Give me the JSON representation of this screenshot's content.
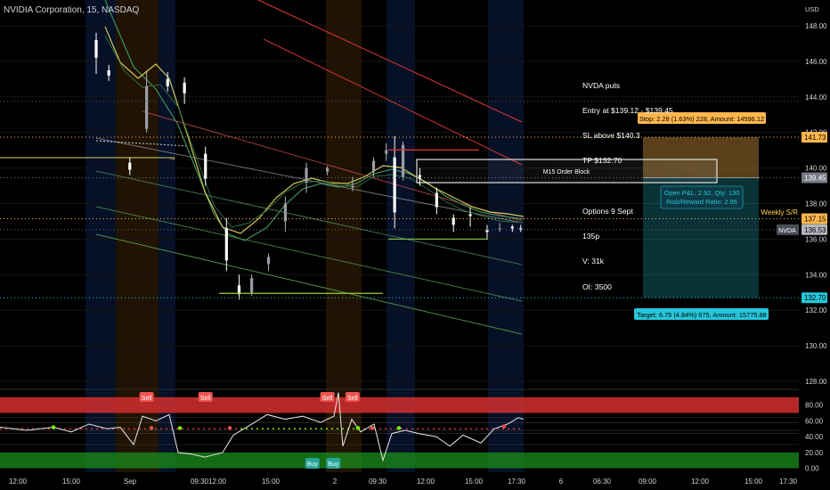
{
  "header": {
    "title": "NVIDIA Corporation, 15, NASDAQ"
  },
  "trade_note": {
    "entry_lines": [
      "NVDA puts",
      "Entry at $139.12 - $139.45",
      "SL above $140.3",
      "TP $132.70"
    ],
    "option_lines": [
      "Options 9 Sept",
      "135p",
      "V: 31k",
      "OI: 3500"
    ]
  },
  "labels": {
    "order_block": "M15 Order Block",
    "stop_box": "Stop: 2.28 (1.63%) 228, Amount: 14596.12",
    "pnl_line1": "Open P&L: 2.92, Qty: 130",
    "pnl_line2": "Risk/Reward Ratio: 2.96",
    "target_box": "Target: 6.75 (4.84%) 675, Amount: 15775.88",
    "weekly_sr": "Weekly S/R",
    "symbol_tag": "NVDA",
    "currency": "USD",
    "sell": "Sell",
    "buy": "Buy"
  },
  "price_tags": [
    {
      "value": "141.73",
      "price": 141.73,
      "bg": "#ffb74d",
      "fg": "#000000"
    },
    {
      "value": "139.45",
      "price": 139.45,
      "bg": "#787b86",
      "fg": "#ffffff"
    },
    {
      "value": "137.15",
      "price": 137.15,
      "bg": "#ffb74d",
      "fg": "#000000"
    },
    {
      "value": "136.53",
      "price": 136.53,
      "bg": "#b2b5be",
      "fg": "#000000"
    },
    {
      "value": "132.70",
      "price": 132.7,
      "bg": "#26c6da",
      "fg": "#000000"
    }
  ],
  "colors": {
    "up": "#26a69a",
    "down": "#ef5350",
    "stop_zone": "#ffb74d",
    "target_zone": "#26c6da",
    "ema_yellow": "#d4c95a",
    "ema_green": "#3e8e5a",
    "ma_red": "#e53935"
  },
  "chart_data": {
    "type": "candlestick",
    "symbol": "NVDA",
    "timeframe": "15",
    "exchange": "NASDAQ",
    "y_axis": {
      "ticks": [
        148.0,
        146.0,
        144.0,
        142.0,
        140.0,
        138.0,
        136.0,
        134.0,
        132.0,
        130.0,
        128.0
      ],
      "range": [
        127.7,
        149.3
      ]
    },
    "x_axis": {
      "ticks": [
        "12:00",
        "15:00",
        "Sep",
        "09:30",
        "12:00",
        "15:00",
        "2",
        "09:30",
        "12:00",
        "15:00",
        "17:30",
        "6",
        "06:30",
        "09:00",
        "12:00",
        "15:00",
        "17:30"
      ]
    },
    "candles_est": [
      {
        "i": 0,
        "o": 147.2,
        "h": 147.6,
        "c": 146.2,
        "l": 145.3
      },
      {
        "i": 3,
        "o": 145.5,
        "h": 145.8,
        "c": 145.2,
        "l": 144.9
      },
      {
        "i": 8,
        "o": 140.3,
        "h": 140.6,
        "c": 139.9,
        "l": 139.6
      },
      {
        "i": 12,
        "o": 142.2,
        "h": 145.5,
        "c": 144.6,
        "l": 142.0
      },
      {
        "i": 17,
        "o": 145.0,
        "h": 145.4,
        "c": 144.6,
        "l": 144.3
      },
      {
        "i": 21,
        "o": 144.8,
        "h": 145.1,
        "c": 144.2,
        "l": 143.6
      },
      {
        "i": 26,
        "o": 140.8,
        "h": 141.2,
        "c": 139.4,
        "l": 139.0
      },
      {
        "i": 31,
        "o": 136.6,
        "h": 137.2,
        "c": 134.8,
        "l": 134.2
      },
      {
        "i": 34,
        "o": 133.4,
        "h": 134.0,
        "c": 132.9,
        "l": 132.6
      },
      {
        "i": 37,
        "o": 133.0,
        "h": 134.0,
        "c": 133.8,
        "l": 132.8
      },
      {
        "i": 41,
        "o": 134.6,
        "h": 135.2,
        "c": 135.0,
        "l": 134.2
      },
      {
        "i": 45,
        "o": 137.0,
        "h": 138.4,
        "c": 138.0,
        "l": 136.4
      },
      {
        "i": 50,
        "o": 139.2,
        "h": 140.3,
        "c": 140.0,
        "l": 138.6
      },
      {
        "i": 55,
        "o": 139.8,
        "h": 140.1,
        "c": 140.0,
        "l": 139.6
      },
      {
        "i": 61,
        "o": 138.9,
        "h": 139.5,
        "c": 139.0,
        "l": 138.7
      },
      {
        "i": 66,
        "o": 139.8,
        "h": 140.6,
        "c": 140.4,
        "l": 139.5
      },
      {
        "i": 69,
        "o": 140.8,
        "h": 141.4,
        "c": 141.0,
        "l": 140.4
      },
      {
        "i": 71,
        "o": 140.6,
        "h": 141.8,
        "c": 137.5,
        "l": 136.6
      },
      {
        "i": 73,
        "o": 139.5,
        "h": 141.5,
        "c": 141.3,
        "l": 139.3
      },
      {
        "i": 77,
        "o": 139.6,
        "h": 140.0,
        "c": 139.4,
        "l": 139.0
      },
      {
        "i": 81,
        "o": 138.6,
        "h": 138.9,
        "c": 137.8,
        "l": 137.4
      },
      {
        "i": 85,
        "o": 137.2,
        "h": 137.4,
        "c": 136.8,
        "l": 136.4
      },
      {
        "i": 89,
        "o": 137.4,
        "h": 137.8,
        "c": 137.3,
        "l": 136.7
      },
      {
        "i": 93,
        "o": 136.5,
        "h": 136.8,
        "c": 136.4,
        "l": 136.0
      },
      {
        "i": 96,
        "o": 136.6,
        "h": 136.9,
        "c": 136.6,
        "l": 136.4
      },
      {
        "i": 99,
        "o": 136.7,
        "h": 136.8,
        "c": 136.6,
        "l": 136.4
      },
      {
        "i": 101,
        "o": 136.6,
        "h": 136.8,
        "c": 136.53,
        "l": 136.4
      }
    ],
    "order_block": {
      "from": 139.45,
      "to": 141.1,
      "label": "M15 Order Block"
    },
    "position": {
      "side": "short",
      "entry": 139.45,
      "stop": 141.73,
      "target": 132.7,
      "stop_text": "Stop: 2.28 (1.63%) 228, Amount: 14596.12",
      "target_text": "Target: 6.75 (4.84%) 675, Amount: 15775.88",
      "pnl_text": [
        "Open P&L: 2.92, Qty: 130",
        "Risk/Reward Ratio: 2.96"
      ]
    },
    "levels": {
      "weekly_sr": 137.15,
      "last_price": 136.53
    },
    "oscillator": {
      "y_ticks": [
        80.0,
        60.0,
        40.0,
        20.0,
        0.0
      ],
      "range": [
        -5,
        100
      ],
      "overbought_band": [
        70,
        90
      ],
      "oversold_band": [
        0,
        20
      ],
      "sell_markers_at_index": [
        12,
        26,
        55,
        61
      ],
      "buy_markers_at_index": [
        51,
        56
      ]
    }
  }
}
